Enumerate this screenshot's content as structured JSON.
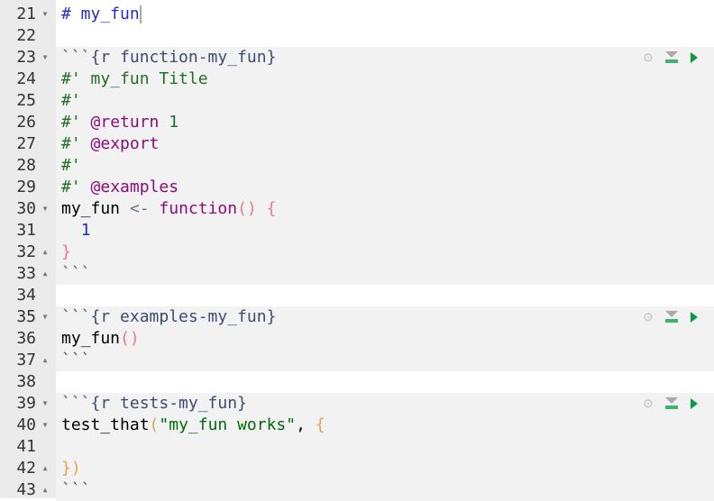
{
  "lines": [
    {
      "n": "21",
      "fold": "down",
      "parts": [
        [
          "md",
          "# my_fun"
        ]
      ],
      "cursor": true
    },
    {
      "n": "22",
      "parts": []
    },
    {
      "n": "23",
      "fold": "down",
      "parts": [
        [
          "hdr",
          "```{r function-my_fun}"
        ]
      ],
      "chunk_tools": true
    },
    {
      "n": "24",
      "parts": [
        [
          "cm",
          "#' my_fun Title"
        ]
      ]
    },
    {
      "n": "25",
      "parts": [
        [
          "cm",
          "#'"
        ]
      ]
    },
    {
      "n": "26",
      "parts": [
        [
          "cm",
          "#' "
        ],
        [
          "kw",
          "@return"
        ],
        [
          "cm",
          " 1"
        ]
      ]
    },
    {
      "n": "27",
      "parts": [
        [
          "cm",
          "#' "
        ],
        [
          "kw",
          "@export"
        ]
      ]
    },
    {
      "n": "28",
      "parts": [
        [
          "cm",
          "#'"
        ]
      ]
    },
    {
      "n": "29",
      "parts": [
        [
          "cm",
          "#' "
        ],
        [
          "kw",
          "@examples"
        ]
      ]
    },
    {
      "n": "30",
      "fold": "down",
      "parts": [
        [
          "",
          "my_fun "
        ],
        [
          "op",
          "<-"
        ],
        [
          "",
          " "
        ],
        [
          "kw",
          "function"
        ],
        [
          "par",
          "()"
        ],
        [
          "",
          " "
        ],
        [
          "par",
          "{"
        ]
      ]
    },
    {
      "n": "31",
      "parts": [
        [
          "",
          "  "
        ],
        [
          "num",
          "1"
        ]
      ]
    },
    {
      "n": "32",
      "fold": "up",
      "parts": [
        [
          "par",
          "}"
        ]
      ]
    },
    {
      "n": "33",
      "fold": "up",
      "parts": [
        [
          "hdr",
          "```"
        ]
      ]
    },
    {
      "n": "34",
      "parts": []
    },
    {
      "n": "35",
      "fold": "down",
      "parts": [
        [
          "hdr",
          "```{r examples-my_fun}"
        ]
      ],
      "chunk_tools": true
    },
    {
      "n": "36",
      "parts": [
        [
          "",
          "my_fun"
        ],
        [
          "par",
          "()"
        ]
      ]
    },
    {
      "n": "37",
      "fold": "up",
      "parts": [
        [
          "hdr",
          "```"
        ]
      ]
    },
    {
      "n": "38",
      "parts": []
    },
    {
      "n": "39",
      "fold": "down",
      "parts": [
        [
          "hdr",
          "```{r tests-my_fun}"
        ]
      ],
      "chunk_tools": true
    },
    {
      "n": "40",
      "fold": "down",
      "parts": [
        [
          "",
          "test_that"
        ],
        [
          "brace",
          "("
        ],
        [
          "str",
          "\"my_fun works\""
        ],
        [
          "",
          ", "
        ],
        [
          "brace",
          "{"
        ]
      ]
    },
    {
      "n": "41",
      "parts": []
    },
    {
      "n": "42",
      "fold": "up",
      "parts": [
        [
          "brace",
          "})"
        ]
      ]
    },
    {
      "n": "43",
      "fold": "up",
      "parts": [
        [
          "hdr",
          "```"
        ]
      ]
    }
  ],
  "chunks": [
    [
      23,
      33
    ],
    [
      35,
      37
    ],
    [
      39,
      43
    ]
  ],
  "icons": {
    "settings": "gear-icon",
    "run_above": "run-previous-chunks-icon",
    "run": "run-chunk-icon"
  }
}
